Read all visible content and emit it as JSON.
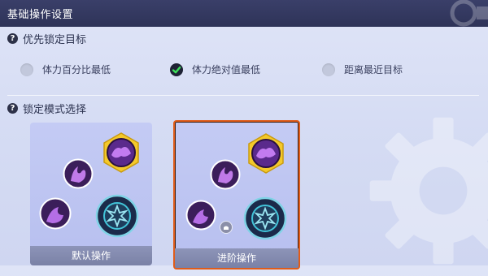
{
  "header": {
    "title": "基础操作设置"
  },
  "priority_section": {
    "heading": "优先锁定目标",
    "options": [
      {
        "label": "体力百分比最低",
        "selected": false
      },
      {
        "label": "体力绝对值最低",
        "selected": true
      },
      {
        "label": "距离最近目标",
        "selected": false
      }
    ]
  },
  "lock_mode_section": {
    "heading": "锁定模式选择",
    "cards": [
      {
        "label": "默认操作",
        "selected": false
      },
      {
        "label": "进阶操作",
        "selected": true
      }
    ]
  },
  "colors": {
    "header_bg": "#2e3358",
    "card_bg": "#c0c7f2",
    "selected_border": "#e05c1a",
    "skill_gold": "#f4c92a",
    "skill_purple": "#8a3fd1",
    "attack_teal": "#41c3d8"
  }
}
